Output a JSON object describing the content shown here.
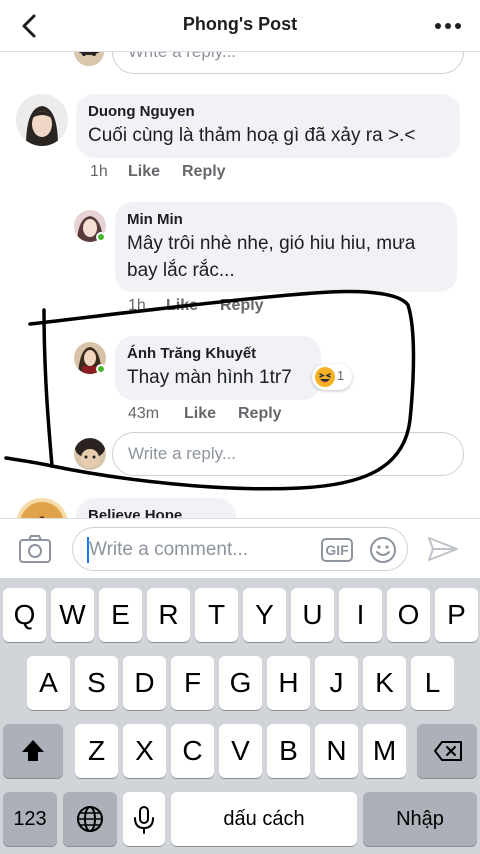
{
  "header": {
    "title": "Phong's Post"
  },
  "comments": [
    {
      "name": "Duong Nguyen",
      "text": "Cuối cùng là thảm hoạ gì đã xảy ra >.<",
      "time": "1h",
      "like": "Like",
      "reply": "Reply"
    }
  ],
  "replies": [
    {
      "name": "Min Min",
      "text_line1": "Mây trôi nhè nhẹ, gió hiu hiu, mưa",
      "text_line2": "bay lắc rắc...",
      "time": "1h",
      "like": "Like",
      "reply": "Reply"
    },
    {
      "name": "Ánh Trăng Khuyết",
      "text": "Thay màn hình 1tr7",
      "time": "43m",
      "like": "Like",
      "reply": "Reply",
      "reaction_count": "1",
      "reaction_icon": "haha-emoji-icon"
    }
  ],
  "reply_placeholder": "Write a reply...",
  "next_comment_name": "Believe Hope",
  "comment_bar": {
    "placeholder": "Write a comment...",
    "gif_label": "GIF"
  },
  "keyboard": {
    "row1": [
      "Q",
      "W",
      "E",
      "R",
      "T",
      "Y",
      "U",
      "I",
      "O",
      "P"
    ],
    "row2": [
      "A",
      "S",
      "D",
      "F",
      "G",
      "H",
      "J",
      "K",
      "L"
    ],
    "row3": [
      "Z",
      "X",
      "C",
      "V",
      "B",
      "N",
      "M"
    ],
    "numbers_key": "123",
    "space_key": "dấu cách",
    "return_key": "Nhập"
  },
  "colors": {
    "accent": "#1877f2",
    "online": "#42b72a",
    "bubble": "#f0f2f5",
    "annotation_ink": "#000000"
  }
}
